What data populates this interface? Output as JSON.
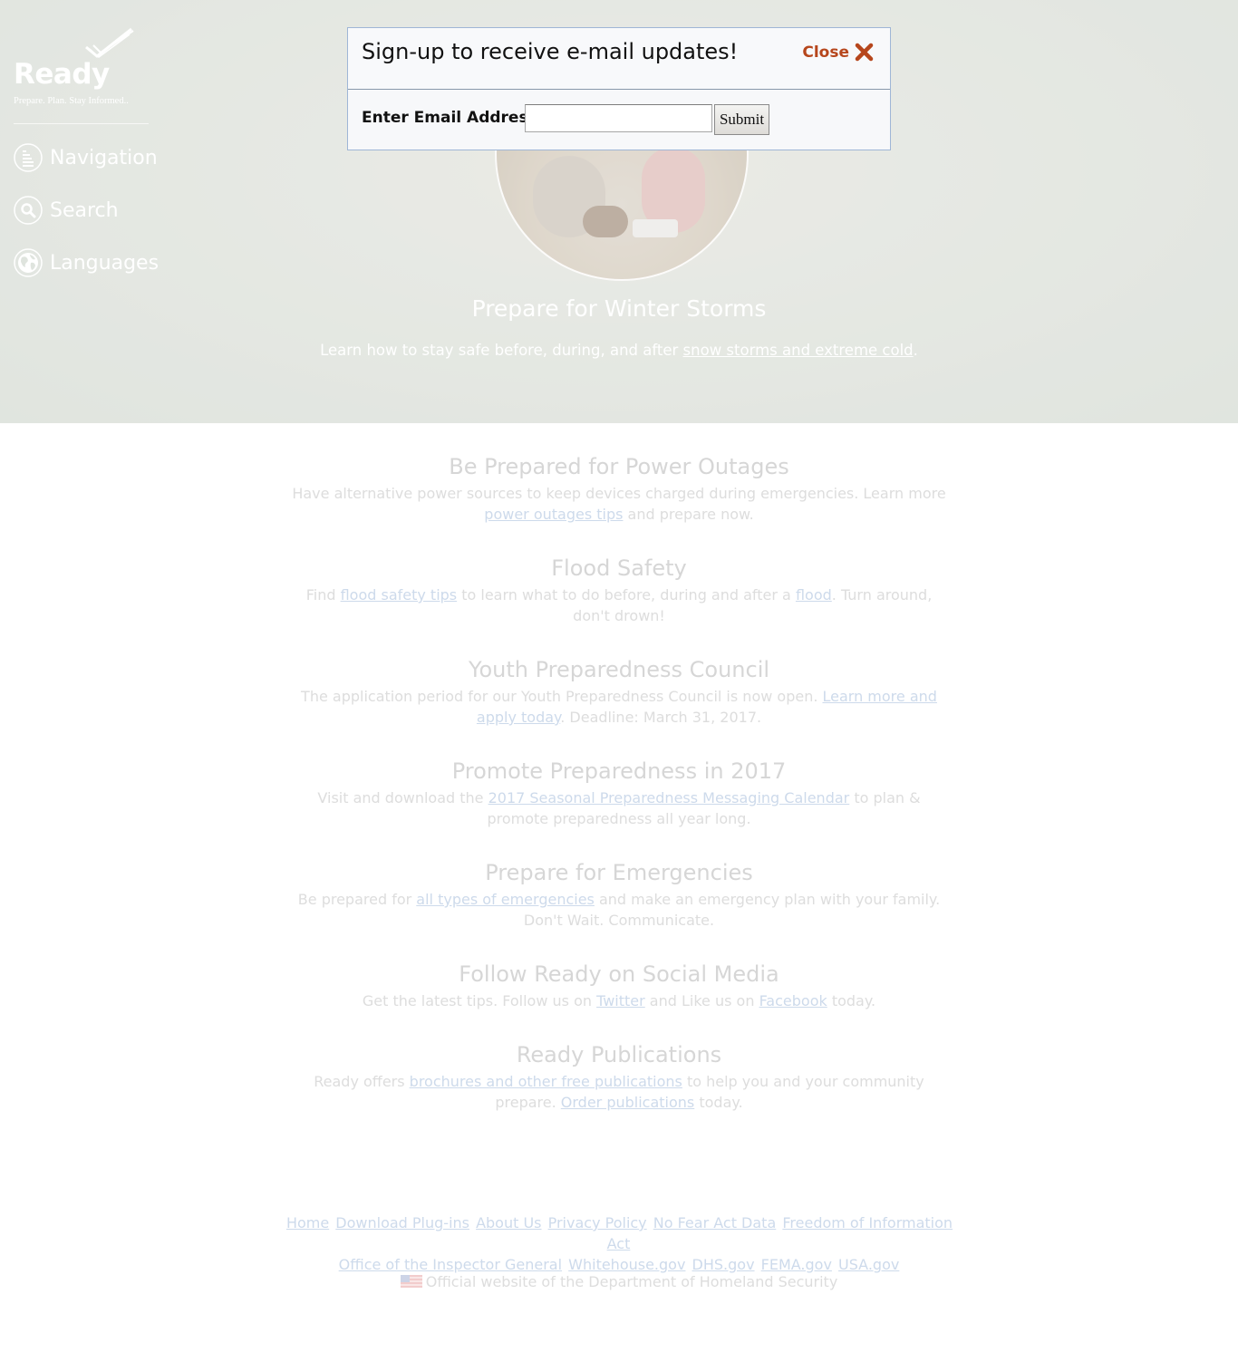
{
  "brand": {
    "name": "Ready",
    "tagline": "Prepare. Plan. Stay Informed.."
  },
  "sidebar": {
    "items": [
      {
        "label": "Navigation",
        "icon": "navigation-icon"
      },
      {
        "label": "Search",
        "icon": "search-icon"
      },
      {
        "label": "Languages",
        "icon": "globe-icon"
      }
    ]
  },
  "hero": {
    "title": "Prepare for Winter Storms",
    "sub_prefix": "Learn how to stay safe before, during, and after ",
    "sub_link": "snow storms and extreme cold",
    "sub_suffix": "."
  },
  "sections": [
    {
      "title": "Be Prepared for Power Outages",
      "p1": "Have alternative power sources to keep devices charged during emergencies. Learn more ",
      "link1": "power outages tips",
      "p2": " and prepare now."
    },
    {
      "title": "Flood Safety",
      "p1": "Find ",
      "link1": "flood safety tips",
      "p2": " to learn what to do before, during and after a ",
      "link2": "flood",
      "p3": ". Turn around, don't drown!"
    },
    {
      "title": "Youth Preparedness Council",
      "p1": "The application period for our Youth Preparedness Council is now open. ",
      "link1": "Learn more and apply today",
      "p2": ". Deadline: March 31, 2017."
    },
    {
      "title": "Promote Preparedness in 2017",
      "p1": "Visit and download the ",
      "link1": "2017 Seasonal Preparedness Messaging Calendar",
      "p2": " to plan & promote preparedness all year long."
    },
    {
      "title": "Prepare for Emergencies",
      "p1": "Be prepared for ",
      "link1": "all types of emergencies",
      "p2": " and make an emergency plan with your family. Don't Wait. Communicate."
    },
    {
      "title": "Follow Ready on Social Media",
      "p1": "Get the latest tips. Follow us on ",
      "link1": "Twitter",
      "p2": " and Like us on ",
      "link2": "Facebook",
      "p3": " today."
    },
    {
      "title": "Ready Publications",
      "p1": "Ready offers ",
      "link1": "brochures and other free publications",
      "p2": " to help you and your community prepare. ",
      "link2": "Order publications",
      "p3": " today."
    }
  ],
  "footer": {
    "links": [
      "Home",
      "Download Plug-ins",
      "About Us",
      "Privacy Policy",
      "No Fear Act Data",
      "Freedom of Information Act",
      "Office of the Inspector General",
      "Whitehouse.gov",
      "DHS.gov",
      "FEMA.gov",
      "USA.gov"
    ],
    "official": "Official website of the Department of Homeland Security"
  },
  "modal": {
    "title": "Sign-up to receive e-mail updates!",
    "close_label": "Close",
    "email_label": "Enter Email Address",
    "email_value": "",
    "email_placeholder": "",
    "submit_label": "Submit"
  },
  "colors": {
    "close_accent": "#b6461c",
    "link": "#a9bfdc",
    "hero_bg": "#d3d8cf"
  }
}
